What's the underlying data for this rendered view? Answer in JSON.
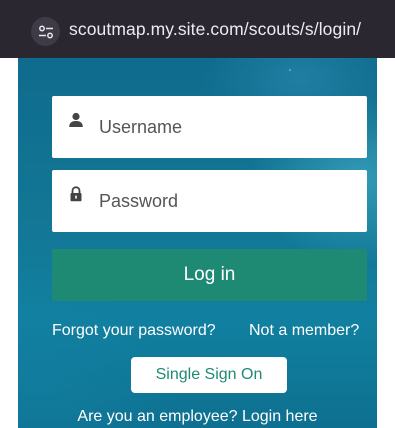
{
  "browser": {
    "url": "scoutmap.my.site.com/scouts/s/login/",
    "site_settings_icon": "tune-icon"
  },
  "login_form": {
    "username_placeholder": "Username",
    "username_value": "",
    "username_icon": "person-icon",
    "password_placeholder": "Password",
    "password_value": "",
    "password_icon": "lock-icon",
    "login_label": "Log in",
    "forgot_label": "Forgot your password?",
    "not_member_label": "Not a member?",
    "sso_label": "Single Sign On",
    "employee_label": "Are you an employee? Login here"
  },
  "colors": {
    "primary_green": "#1f8a74",
    "background_blue": "#0f6b8d",
    "address_bar": "#2a2730"
  }
}
